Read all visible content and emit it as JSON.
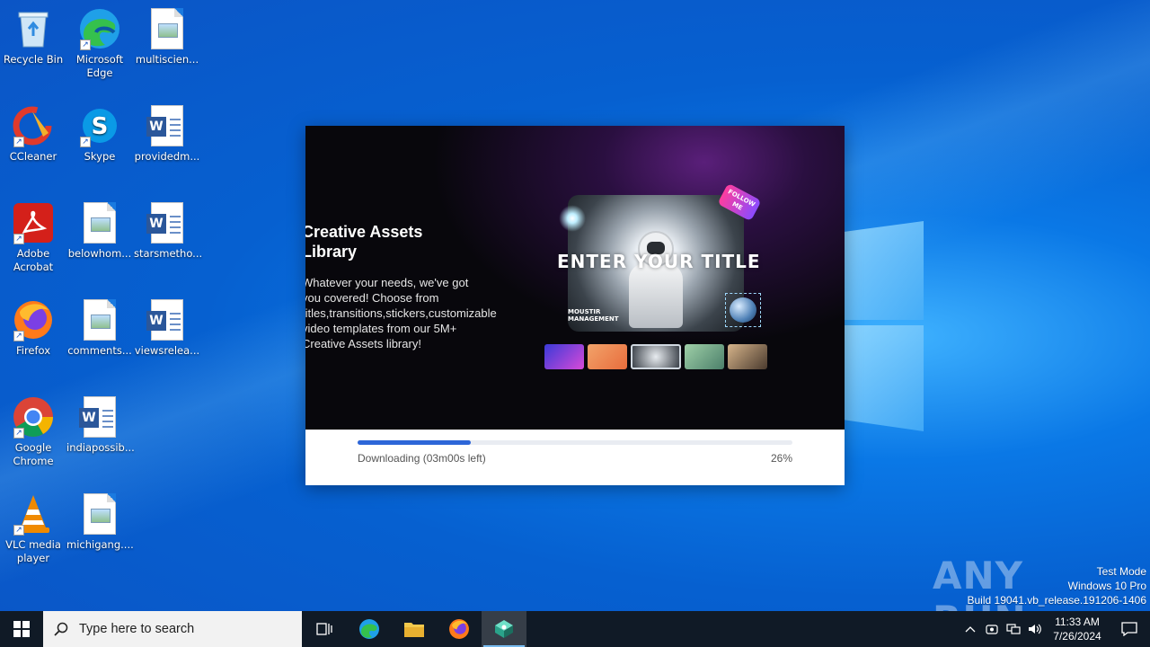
{
  "desktop": {
    "icons": [
      {
        "label": "Recycle Bin"
      },
      {
        "label": "Microsoft Edge"
      },
      {
        "label": "multiscien..."
      },
      {
        "label": "CCleaner"
      },
      {
        "label": "Skype"
      },
      {
        "label": "providedm..."
      },
      {
        "label": "Adobe Acrobat"
      },
      {
        "label": "belowhom..."
      },
      {
        "label": "starsmetho..."
      },
      {
        "label": "Firefox"
      },
      {
        "label": "comments..."
      },
      {
        "label": "viewsrelea..."
      },
      {
        "label": "Google Chrome"
      },
      {
        "label": "indiapossib..."
      },
      {
        "label": "VLC media player"
      },
      {
        "label": "michigang...."
      }
    ]
  },
  "installer": {
    "hero_title": "Creative Assets Library",
    "hero_description": "Whatever your needs, we've got you covered! Choose from titles,transitions,stickers,customizable video templates from our 5M+ Creative Assets library!",
    "showcase_title": "ENTER YOUR TITLE",
    "follow_badge": "FOLLOW ME",
    "showcase_caption": "MOUSTIR MANAGEMENT",
    "progress_status": "Downloading (03m00s left)",
    "progress_percent_label": "26%",
    "progress_value": 0.26
  },
  "watermark": {
    "brand": "ANY RUN",
    "line1": "Test Mode",
    "line2": "Windows 10 Pro",
    "line3": "Build 19041.vb_release.191206-1406"
  },
  "taskbar": {
    "search_placeholder": "Type here to search",
    "time": "11:33 AM",
    "date": "7/26/2024"
  },
  "colors": {
    "progress_fill": "#2d66d8",
    "taskbar_bg": "#101a26",
    "desktop_blue": "#0660d0"
  }
}
